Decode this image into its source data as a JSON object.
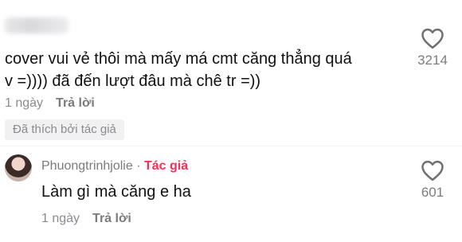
{
  "comment": {
    "line1": "cover vui vẻ thôi mà mấy má cmt căng thẳng quá",
    "line2": "v =)))) đã đến lượt đâu mà chê tr =))",
    "time": "1 ngày",
    "reply_label": "Trả lời",
    "liked_by_author": "Đã thích bởi tác giả",
    "like_icon": "heart-outline-icon",
    "like_count": "3214"
  },
  "reply": {
    "username": "Phuongtrinhjolie",
    "separator": " · ",
    "author_tag": "Tác giả",
    "text": "Làm gì mà căng e ha",
    "time": "1 ngày",
    "reply_label": "Trả lời",
    "like_icon": "heart-outline-icon",
    "like_count": "601"
  },
  "colors": {
    "author_tag": "#fe2c55",
    "meta_text": "#8a8b91",
    "badge_bg": "#f1f1f2"
  }
}
